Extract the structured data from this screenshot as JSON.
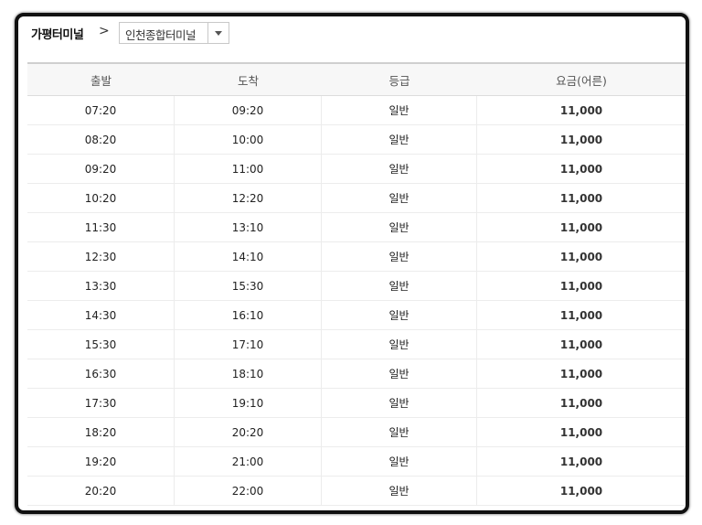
{
  "route": {
    "origin": "가평터미널",
    "separator": ">",
    "destination_selected": "인천종합터미널"
  },
  "table": {
    "headers": [
      "출발",
      "도착",
      "등급",
      "요금(어른)"
    ],
    "rows": [
      {
        "departure": "07:20",
        "arrival": "09:20",
        "grade": "일반",
        "fare": "11,000"
      },
      {
        "departure": "08:20",
        "arrival": "10:00",
        "grade": "일반",
        "fare": "11,000"
      },
      {
        "departure": "09:20",
        "arrival": "11:00",
        "grade": "일반",
        "fare": "11,000"
      },
      {
        "departure": "10:20",
        "arrival": "12:20",
        "grade": "일반",
        "fare": "11,000"
      },
      {
        "departure": "11:30",
        "arrival": "13:10",
        "grade": "일반",
        "fare": "11,000"
      },
      {
        "departure": "12:30",
        "arrival": "14:10",
        "grade": "일반",
        "fare": "11,000"
      },
      {
        "departure": "13:30",
        "arrival": "15:30",
        "grade": "일반",
        "fare": "11,000"
      },
      {
        "departure": "14:30",
        "arrival": "16:10",
        "grade": "일반",
        "fare": "11,000"
      },
      {
        "departure": "15:30",
        "arrival": "17:10",
        "grade": "일반",
        "fare": "11,000"
      },
      {
        "departure": "16:30",
        "arrival": "18:10",
        "grade": "일반",
        "fare": "11,000"
      },
      {
        "departure": "17:30",
        "arrival": "19:10",
        "grade": "일반",
        "fare": "11,000"
      },
      {
        "departure": "18:20",
        "arrival": "20:20",
        "grade": "일반",
        "fare": "11,000"
      },
      {
        "departure": "19:20",
        "arrival": "21:00",
        "grade": "일반",
        "fare": "11,000"
      },
      {
        "departure": "20:20",
        "arrival": "22:00",
        "grade": "일반",
        "fare": "11,000"
      }
    ]
  }
}
